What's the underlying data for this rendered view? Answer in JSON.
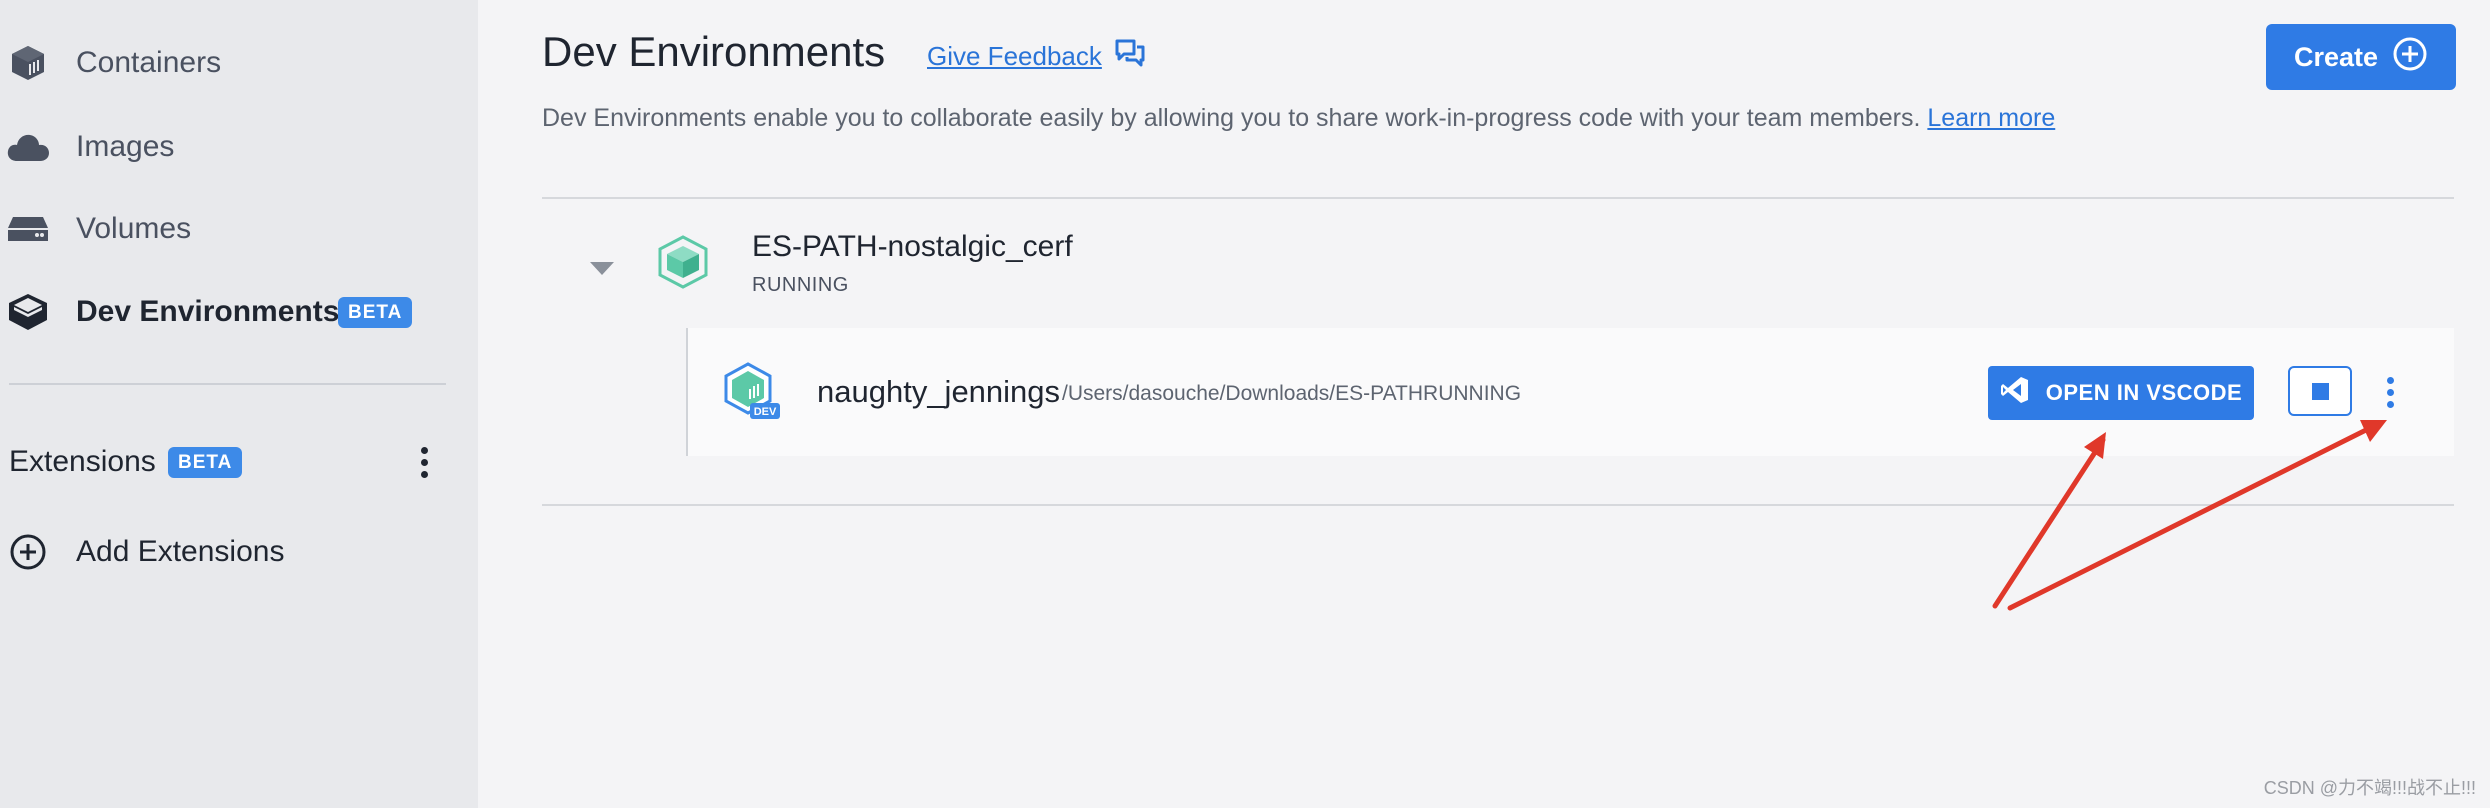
{
  "sidebar": {
    "items": [
      {
        "label": "Containers",
        "icon": "container-icon"
      },
      {
        "label": "Images",
        "icon": "cloud-icon"
      },
      {
        "label": "Volumes",
        "icon": "volume-icon"
      },
      {
        "label": "Dev Environments",
        "icon": "dev-env-icon",
        "badge": "BETA",
        "active": true
      }
    ],
    "extensions": {
      "label": "Extensions",
      "badge": "BETA"
    },
    "add_extensions": {
      "label": "Add Extensions",
      "icon": "plus-circle-icon"
    }
  },
  "header": {
    "title": "Dev Environments",
    "feedback_label": "Give Feedback",
    "create_label": "Create",
    "description": "Dev Environments enable you to collaborate easily by allowing you to share work-in-progress code with your team members.",
    "learn_more": "Learn more"
  },
  "environment": {
    "name": "ES-PATH-nostalgic_cerf",
    "status": "RUNNING",
    "container": {
      "name": "naughty_jennings",
      "path": "/Users/dasouche/Downloads/ES-PATHRUNNING",
      "open_label": "OPEN IN VSCODE",
      "dev_badge": "DEV"
    }
  },
  "watermark": "CSDN @力不竭!!!战不止!!!",
  "colors": {
    "accent": "#2f7be5",
    "teal": "#5cc9a7",
    "arrow": "#e0382a"
  }
}
